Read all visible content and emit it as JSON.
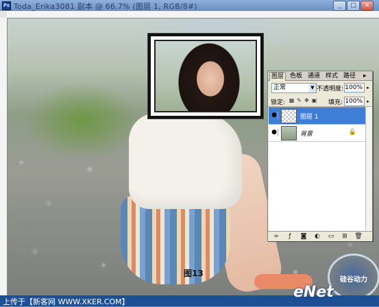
{
  "window": {
    "title": "Toda_Erika3081 副本 @ 66.7% (图层 1, RGB/8#)",
    "controls": [
      "_",
      "□",
      "×"
    ]
  },
  "canvas": {
    "caption": "图13"
  },
  "layers_panel": {
    "tabs": [
      "图层",
      "色板",
      "通道",
      "样式",
      "路径"
    ],
    "blend_mode": "正常",
    "opacity_label": "不透明度:",
    "opacity_value": "100%",
    "lock_label": "锁定:",
    "fill_label": "填充:",
    "fill_value": "100%",
    "layers": [
      {
        "name": "图层 1",
        "selected": true,
        "thumb": "transparent"
      },
      {
        "name": "背景",
        "selected": false,
        "thumb": "photo",
        "locked": true
      }
    ]
  },
  "watermark": {
    "bottom_left": "上传于【新客网 WWW.XKER.COM】",
    "logo_text": "eNet",
    "badge_text": "硅谷动力"
  },
  "colors": {
    "accent_selected": "#3f7ed6",
    "title_bar": "#7a9cc7"
  }
}
